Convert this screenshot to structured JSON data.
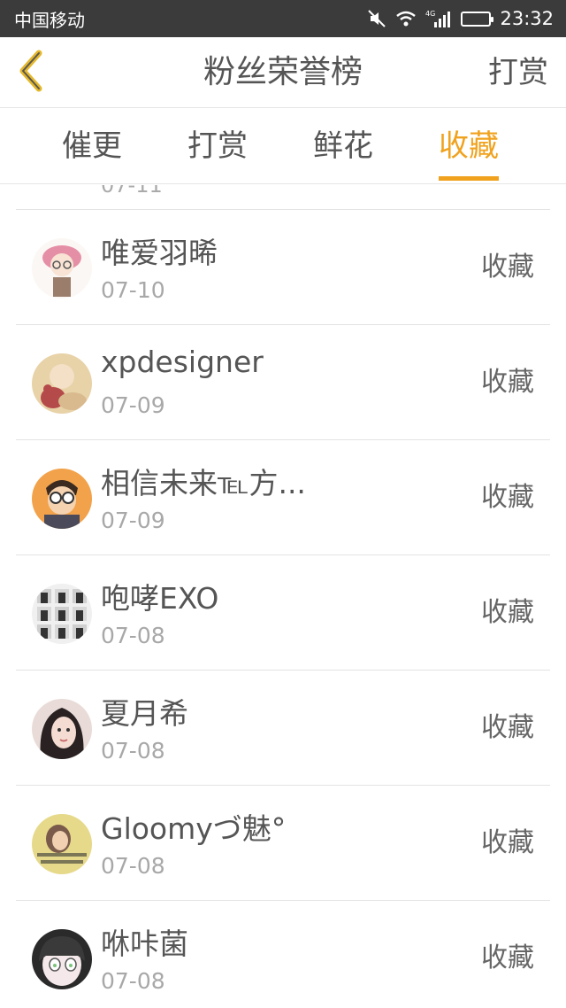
{
  "status_bar": {
    "carrier": "中国移动",
    "network": "4G",
    "time": "23:32"
  },
  "nav": {
    "title": "粉丝荣誉榜",
    "right_action": "打赏",
    "back_icon": "chevron-left-icon",
    "accent_color": "#f0a21e"
  },
  "tabs": [
    {
      "label": "催更",
      "active": false
    },
    {
      "label": "打赏",
      "active": false
    },
    {
      "label": "鲜花",
      "active": false
    },
    {
      "label": "收藏",
      "active": true
    }
  ],
  "list": {
    "partial_top_date": "07-11",
    "items": [
      {
        "name": "唯爱羽晞",
        "date": "07-10",
        "action": "收藏",
        "avatar": "avatar-cartoon-girl-glasses"
      },
      {
        "name": "xpdesigner",
        "date": "07-09",
        "action": "收藏",
        "avatar": "avatar-baby-teddy-bear"
      },
      {
        "name": "相信未来℡方...",
        "date": "07-09",
        "action": "收藏",
        "avatar": "avatar-cartoon-man-glasses"
      },
      {
        "name": "咆哮EXO",
        "date": "07-08",
        "action": "收藏",
        "avatar": "avatar-photo-grid"
      },
      {
        "name": "夏月希",
        "date": "07-08",
        "action": "收藏",
        "avatar": "avatar-girl-photo"
      },
      {
        "name": "Gloomyづ魅°",
        "date": "07-08",
        "action": "收藏",
        "avatar": "avatar-yellow-text-photo"
      },
      {
        "name": "咻咔菌",
        "date": "07-08",
        "action": "收藏",
        "avatar": "avatar-anime-girl"
      }
    ]
  }
}
